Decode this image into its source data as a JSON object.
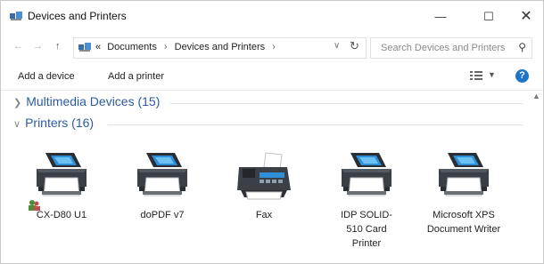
{
  "window": {
    "title": "Devices and Printers",
    "minimize_glyph": "—",
    "maximize_glyph": "☐",
    "close_glyph": "✕"
  },
  "address_bar": {
    "prefix": "«",
    "crumbs": [
      "Documents",
      "Devices and Printers"
    ],
    "separator": "›",
    "search_placeholder": "Search Devices and Printers"
  },
  "toolbar": {
    "add_device": "Add a device",
    "add_printer": "Add a printer",
    "help": "?"
  },
  "groups": [
    {
      "name": "Multimedia Devices (15)",
      "expanded": false
    },
    {
      "name": "Printers (16)",
      "expanded": true
    }
  ],
  "devices": [
    {
      "label": "CX-D80 U1",
      "icon": "printer-icon",
      "default_user_badge": true
    },
    {
      "label": "doPDF v7",
      "icon": "printer-icon"
    },
    {
      "label": "Fax",
      "icon": "fax-icon"
    },
    {
      "label": "IDP SOLID-510 Card Printer",
      "icon": "printer-icon"
    },
    {
      "label": "Microsoft XPS Document Writer",
      "icon": "printer-icon"
    }
  ],
  "colors": {
    "group_heading": "#2d5aa0",
    "help_button": "#1e74c9",
    "printer_body": "#3a3f45",
    "printer_screen": "#2f8fd6"
  }
}
